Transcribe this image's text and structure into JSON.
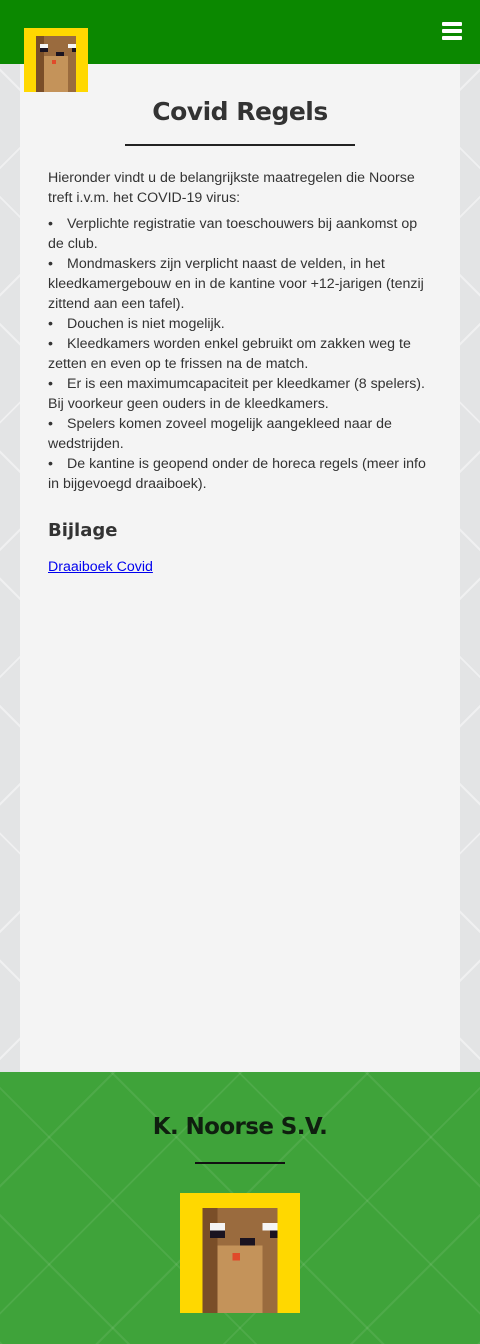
{
  "header": {
    "logo_icon": "beaver-pixel-logo",
    "menu_icon": "hamburger-menu-icon"
  },
  "main": {
    "title": "Covid Regels",
    "intro": "Hieronder vindt u de belangrijkste maatregelen die Noorse treft i.v.m. het COVID-19 virus:",
    "bullet": "•",
    "rules": [
      "Verplichte registratie van toeschouwers bij aankomst op de club.",
      "Mondmaskers zijn verplicht naast de velden, in het kleedkamergebouw en in de kantine voor +12-jarigen (tenzij zittend aan een tafel).",
      "Douchen is niet mogelijk.",
      "Kleedkamers worden enkel gebruikt om zakken weg te zetten en even op te frissen na de match.",
      "Er is een maximumcapaciteit per kleedkamer (8 spelers). Bij voorkeur geen ouders in de kleedkamers.",
      "Spelers komen zoveel mogelijk aangekleed naar de wedstrijden.",
      "De kantine is geopend onder de horeca regels (meer info in bijgevoegd draaiboek)."
    ],
    "attachment_heading": "Bijlage",
    "attachment_link": "Draaiboek Covid"
  },
  "footer": {
    "club_name": "K. Noorse S.V."
  },
  "colors": {
    "header_green": "#0b8800",
    "footer_green": "#3fa33a",
    "logo_yellow": "#ffd800",
    "link_blue": "#0000ee"
  }
}
